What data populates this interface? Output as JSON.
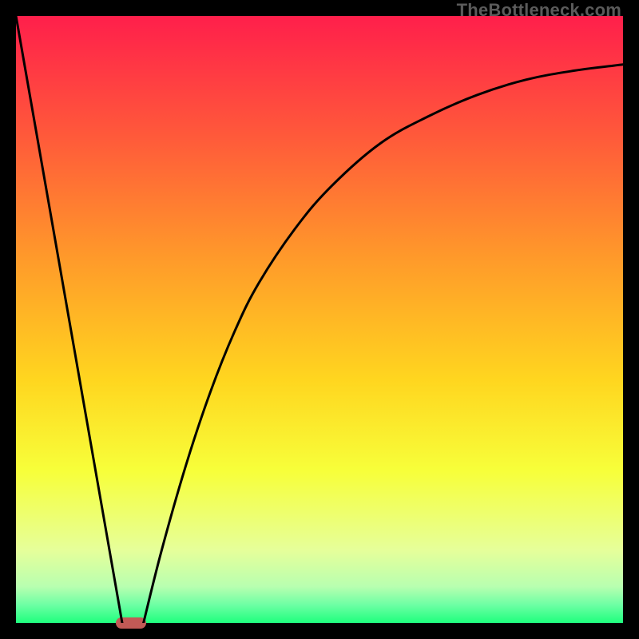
{
  "watermark": "TheBottleneck.com",
  "chart_data": {
    "type": "line",
    "title": "",
    "xlabel": "",
    "ylabel": "",
    "xlim": [
      0,
      100
    ],
    "ylim": [
      0,
      100
    ],
    "gradient": {
      "stops": [
        {
          "pos": 0.0,
          "color": "#ff1f4b"
        },
        {
          "pos": 0.2,
          "color": "#ff5a3a"
        },
        {
          "pos": 0.4,
          "color": "#ff9a2a"
        },
        {
          "pos": 0.6,
          "color": "#ffd61f"
        },
        {
          "pos": 0.75,
          "color": "#f7ff3a"
        },
        {
          "pos": 0.88,
          "color": "#e6ff9a"
        },
        {
          "pos": 0.94,
          "color": "#b8ffb0"
        },
        {
          "pos": 0.97,
          "color": "#6dffa4"
        },
        {
          "pos": 1.0,
          "color": "#1eff7d"
        }
      ]
    },
    "series": [
      {
        "name": "left-line",
        "x": [
          0,
          17.5
        ],
        "y": [
          100,
          0
        ]
      },
      {
        "name": "right-curve",
        "x": [
          21,
          24,
          28,
          32,
          36,
          40,
          46,
          52,
          60,
          68,
          76,
          84,
          92,
          100
        ],
        "y": [
          0,
          12,
          26,
          38,
          48,
          56,
          65,
          72,
          79,
          83.5,
          87,
          89.5,
          91,
          92
        ]
      }
    ],
    "marker": {
      "x_start": 16.5,
      "x_end": 21.5,
      "y": 0,
      "color": "#c25a56"
    }
  }
}
